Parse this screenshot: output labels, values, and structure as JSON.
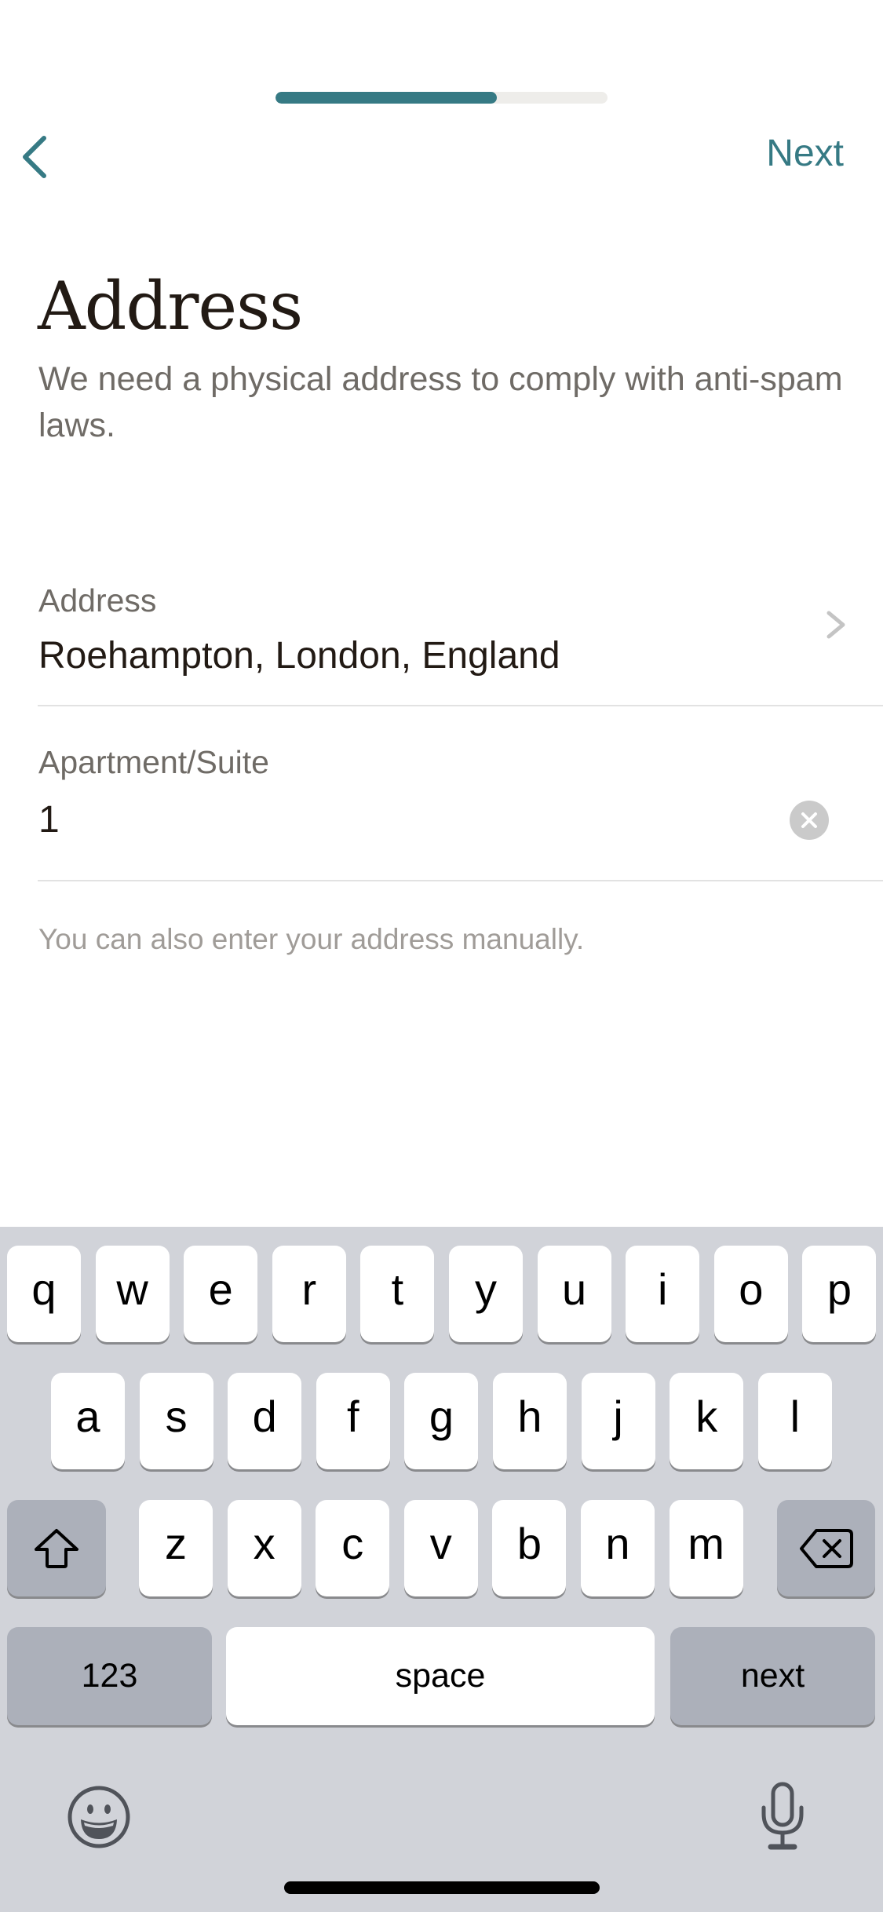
{
  "header": {
    "progress": 0.667,
    "back_icon": "chevron-left-icon",
    "next_label": "Next"
  },
  "page": {
    "title": "Address",
    "subtitle": "We need a physical address to comply with anti-spam laws."
  },
  "form": {
    "address": {
      "label": "Address",
      "value": "Roehampton, London, England",
      "icon": "chevron-right-icon"
    },
    "apartment": {
      "label": "Apartment/Suite",
      "value": "1",
      "icon": "clear-icon"
    },
    "helper_text": "You can also enter your address manually."
  },
  "keyboard": {
    "row1": [
      "q",
      "w",
      "e",
      "r",
      "t",
      "y",
      "u",
      "i",
      "o",
      "p"
    ],
    "row2": [
      "a",
      "s",
      "d",
      "f",
      "g",
      "h",
      "j",
      "k",
      "l"
    ],
    "row3": [
      "z",
      "x",
      "c",
      "v",
      "b",
      "n",
      "m"
    ],
    "shift_icon": "shift-icon",
    "delete_icon": "delete-icon",
    "numbers_label": "123",
    "space_label": "space",
    "return_label": "next",
    "emoji_icon": "emoji-icon",
    "mic_icon": "microphone-icon"
  },
  "colors": {
    "accent": "#367A84",
    "progress_track": "#EEEDEA",
    "title": "#221A14",
    "muted_text": "#6F6B66",
    "helper_text": "#A09C98",
    "keyboard_bg": "#D1D3D9",
    "function_key": "#ACB0BA"
  }
}
